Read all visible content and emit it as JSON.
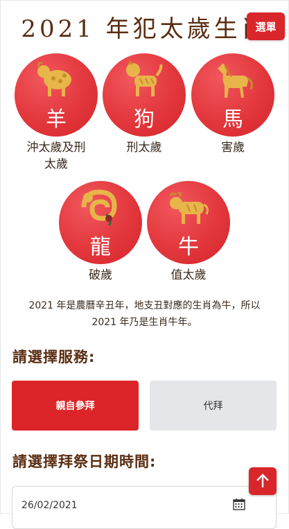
{
  "header": {
    "title": "2021 年犯太歲生肖",
    "menu_label": "選單"
  },
  "zodiacs": [
    {
      "animal": "羊",
      "caption_line1": "沖太歲及刑",
      "caption_line2": "太歲",
      "icon": "goat-icon"
    },
    {
      "animal": "狗",
      "caption_line1": "刑太歲",
      "caption_line2": "",
      "icon": "dog-icon"
    },
    {
      "animal": "馬",
      "caption_line1": "害歲",
      "caption_line2": "",
      "icon": "horse-icon"
    },
    {
      "animal": "龍",
      "caption_line1": "破歲",
      "caption_line2": "",
      "icon": "dragon-icon"
    },
    {
      "animal": "牛",
      "caption_line1": "值太歲",
      "caption_line2": "",
      "icon": "ox-icon"
    }
  ],
  "info": {
    "line1": "2021 年是農曆辛丑年，地支丑對應的生肖為牛，所以",
    "line2": "2021 年乃是生肖牛年。"
  },
  "service": {
    "heading": "請選擇服務:",
    "options": [
      "親自參拜",
      "代拜"
    ],
    "selected": "親自參拜"
  },
  "datetime": {
    "heading": "請選擇拜祭日期時間:",
    "date_value": "26/02/2021"
  },
  "colors": {
    "accent": "#d9262b",
    "heading": "#5a2d12",
    "gold": "#e7b54a"
  }
}
